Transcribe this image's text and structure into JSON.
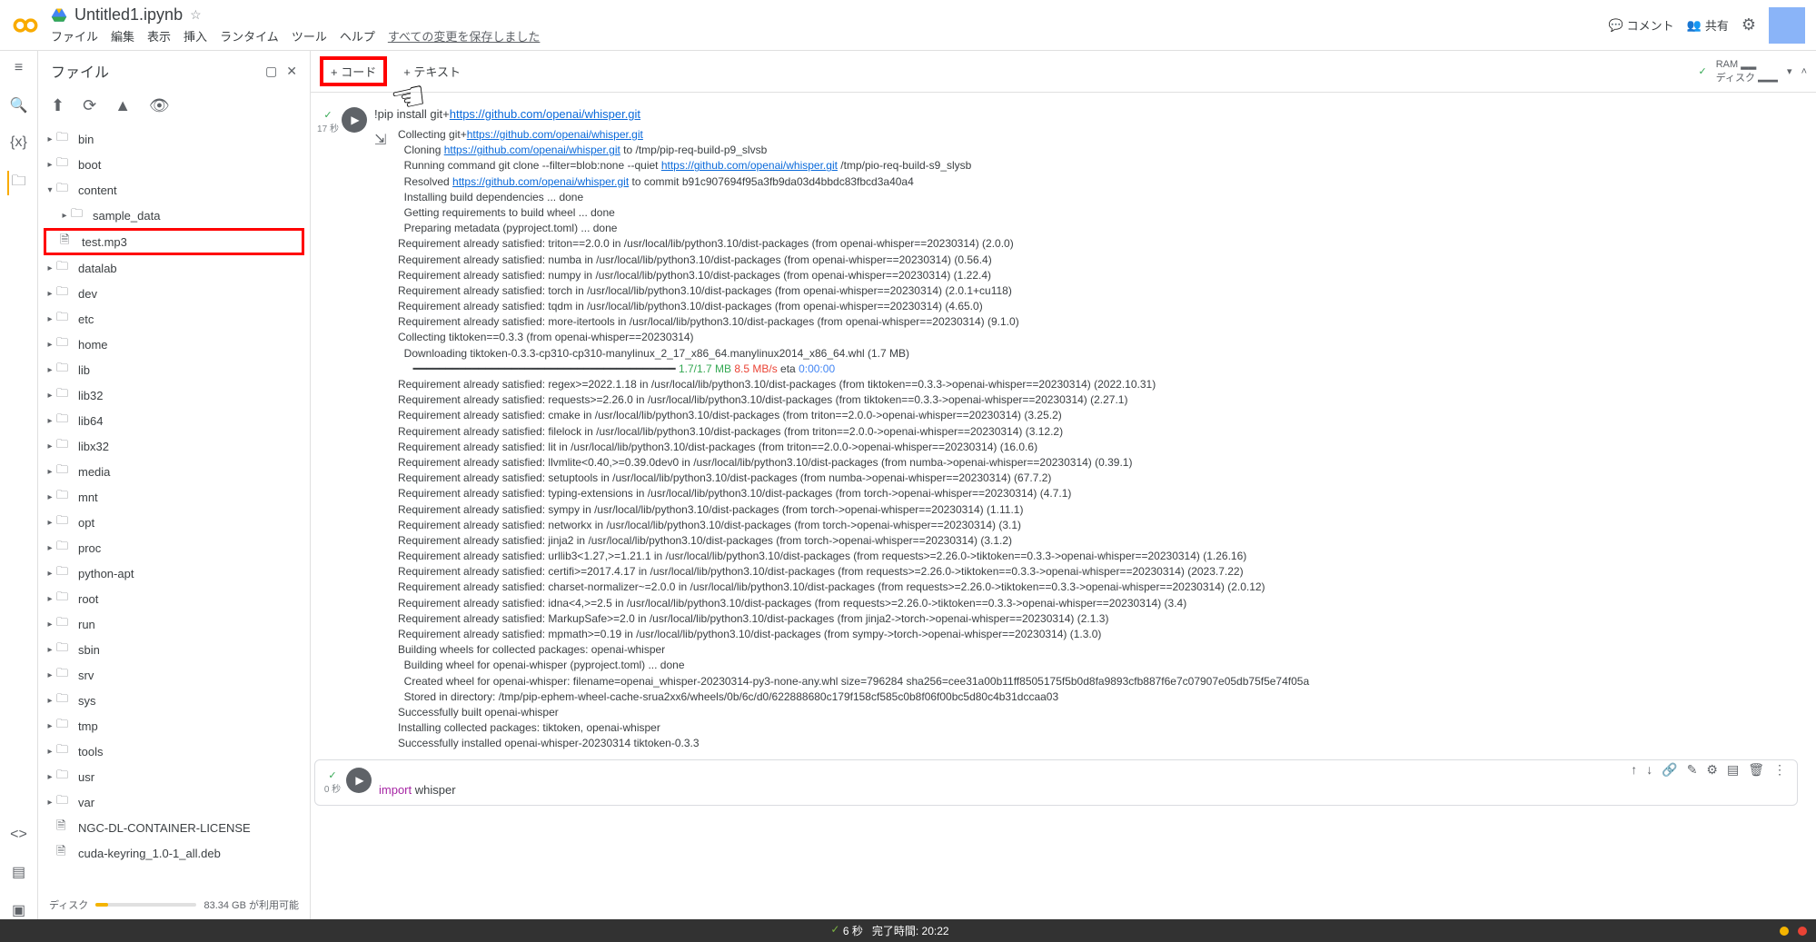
{
  "header": {
    "doc_title": "Untitled1.ipynb",
    "menu": {
      "file": "ファイル",
      "edit": "編集",
      "view": "表示",
      "insert": "挿入",
      "runtime": "ランタイム",
      "tools": "ツール",
      "help": "ヘルプ",
      "save_msg": "すべての変更を保存しました"
    },
    "comment": "コメント",
    "share": "共有"
  },
  "resource": {
    "ram": "RAM",
    "disk": "ディスク"
  },
  "toolbar": {
    "code": "+ コード",
    "text": "+ テキスト"
  },
  "file_pane": {
    "title": "ファイル",
    "tree": {
      "bin": "bin",
      "boot": "boot",
      "content": "content",
      "sample_data": "sample_data",
      "test_mp3": "test.mp3",
      "datalab": "datalab",
      "dev": "dev",
      "etc": "etc",
      "home": "home",
      "lib": "lib",
      "lib32": "lib32",
      "lib64": "lib64",
      "libx32": "libx32",
      "media": "media",
      "mnt": "mnt",
      "opt": "opt",
      "proc": "proc",
      "python_apt": "python-apt",
      "root": "root",
      "run": "run",
      "sbin": "sbin",
      "srv": "srv",
      "sys": "sys",
      "tmp": "tmp",
      "tools": "tools",
      "usr": "usr",
      "var": "var",
      "file1": "NGC-DL-CONTAINER-LICENSE",
      "file2": "cuda-keyring_1.0-1_all.deb"
    },
    "disk_label": "ディスク",
    "disk_avail": "83.34 GB が利用可能"
  },
  "cells": {
    "cell1_count": "17 秒",
    "cell1_code_prefix": "!pip install git+",
    "cell1_code_link": "https://github.com/openai/whisper.git",
    "cell2_kw": "import",
    "cell2_rest": " whisper"
  },
  "output_lines": {
    "l1a": "Collecting git+",
    "l1b": "https://github.com/openai/whisper.git",
    "l2a": "  Cloning ",
    "l2b": "https://github.com/openai/whisper.git",
    "l2c": " to /tmp/pip-req-build-p9_slvsb",
    "l3a": "  Running command git clone --filter=blob:none --quiet ",
    "l3b": "https://github.com/openai/whisper.git",
    "l3c": " /tmp/pio-req-build-s9_slysb",
    "l4a": "  Resolved ",
    "l4b": "https://github.com/openai/whisper.git",
    "l4c": " to commit b91c907694f95a3fb9da03d4bbdc83fbcd3a40a4",
    "l5": "  Installing build dependencies ... done",
    "l6": "  Getting requirements to build wheel ... done",
    "l7": "  Preparing metadata (pyproject.toml) ... done",
    "l8": "Requirement already satisfied: triton==2.0.0 in /usr/local/lib/python3.10/dist-packages (from openai-whisper==20230314) (2.0.0)",
    "l9": "Requirement already satisfied: numba in /usr/local/lib/python3.10/dist-packages (from openai-whisper==20230314) (0.56.4)",
    "l10": "Requirement already satisfied: numpy in /usr/local/lib/python3.10/dist-packages (from openai-whisper==20230314) (1.22.4)",
    "l11": "Requirement already satisfied: torch in /usr/local/lib/python3.10/dist-packages (from openai-whisper==20230314) (2.0.1+cu118)",
    "l12": "Requirement already satisfied: tqdm in /usr/local/lib/python3.10/dist-packages (from openai-whisper==20230314) (4.65.0)",
    "l13": "Requirement already satisfied: more-itertools in /usr/local/lib/python3.10/dist-packages (from openai-whisper==20230314) (9.1.0)",
    "l14": "Collecting tiktoken==0.3.3 (from openai-whisper==20230314)",
    "l15": "  Downloading tiktoken-0.3.3-cp310-cp310-manylinux_2_17_x86_64.manylinux2014_x86_64.whl (1.7 MB)",
    "l16a": "     ━━━━━━━━━━━━━━━━━━━━━━━━━━━━━━━━━━━━━━━━",
    "l16b": " 1.7/1.7 MB",
    "l16c": " 8.5 MB/s",
    "l16d": " eta ",
    "l16e": "0:00:00",
    "l17": "Requirement already satisfied: regex>=2022.1.18 in /usr/local/lib/python3.10/dist-packages (from tiktoken==0.3.3->openai-whisper==20230314) (2022.10.31)",
    "l18": "Requirement already satisfied: requests>=2.26.0 in /usr/local/lib/python3.10/dist-packages (from tiktoken==0.3.3->openai-whisper==20230314) (2.27.1)",
    "l19": "Requirement already satisfied: cmake in /usr/local/lib/python3.10/dist-packages (from triton==2.0.0->openai-whisper==20230314) (3.25.2)",
    "l20": "Requirement already satisfied: filelock in /usr/local/lib/python3.10/dist-packages (from triton==2.0.0->openai-whisper==20230314) (3.12.2)",
    "l21": "Requirement already satisfied: lit in /usr/local/lib/python3.10/dist-packages (from triton==2.0.0->openai-whisper==20230314) (16.0.6)",
    "l22": "Requirement already satisfied: llvmlite<0.40,>=0.39.0dev0 in /usr/local/lib/python3.10/dist-packages (from numba->openai-whisper==20230314) (0.39.1)",
    "l23": "Requirement already satisfied: setuptools in /usr/local/lib/python3.10/dist-packages (from numba->openai-whisper==20230314) (67.7.2)",
    "l24": "Requirement already satisfied: typing-extensions in /usr/local/lib/python3.10/dist-packages (from torch->openai-whisper==20230314) (4.7.1)",
    "l25": "Requirement already satisfied: sympy in /usr/local/lib/python3.10/dist-packages (from torch->openai-whisper==20230314) (1.11.1)",
    "l26": "Requirement already satisfied: networkx in /usr/local/lib/python3.10/dist-packages (from torch->openai-whisper==20230314) (3.1)",
    "l27": "Requirement already satisfied: jinja2 in /usr/local/lib/python3.10/dist-packages (from torch->openai-whisper==20230314) (3.1.2)",
    "l28": "Requirement already satisfied: urllib3<1.27,>=1.21.1 in /usr/local/lib/python3.10/dist-packages (from requests>=2.26.0->tiktoken==0.3.3->openai-whisper==20230314) (1.26.16)",
    "l29": "Requirement already satisfied: certifi>=2017.4.17 in /usr/local/lib/python3.10/dist-packages (from requests>=2.26.0->tiktoken==0.3.3->openai-whisper==20230314) (2023.7.22)",
    "l30": "Requirement already satisfied: charset-normalizer~=2.0.0 in /usr/local/lib/python3.10/dist-packages (from requests>=2.26.0->tiktoken==0.3.3->openai-whisper==20230314) (2.0.12)",
    "l31": "Requirement already satisfied: idna<4,>=2.5 in /usr/local/lib/python3.10/dist-packages (from requests>=2.26.0->tiktoken==0.3.3->openai-whisper==20230314) (3.4)",
    "l32": "Requirement already satisfied: MarkupSafe>=2.0 in /usr/local/lib/python3.10/dist-packages (from jinja2->torch->openai-whisper==20230314) (2.1.3)",
    "l33": "Requirement already satisfied: mpmath>=0.19 in /usr/local/lib/python3.10/dist-packages (from sympy->torch->openai-whisper==20230314) (1.3.0)",
    "l34": "Building wheels for collected packages: openai-whisper",
    "l35": "  Building wheel for openai-whisper (pyproject.toml) ... done",
    "l36": "  Created wheel for openai-whisper: filename=openai_whisper-20230314-py3-none-any.whl size=796284 sha256=cee31a00b11ff8505175f5b0d8fa9893cfb887f6e7c07907e05db75f5e74f05a",
    "l37": "  Stored in directory: /tmp/pip-ephem-wheel-cache-srua2xx6/wheels/0b/6c/d0/622888680c179f158cf585c0b8f06f00bc5d80c4b31dccaa03",
    "l38": "Successfully built openai-whisper",
    "l39": "Installing collected packages: tiktoken, openai-whisper",
    "l40": "Successfully installed openai-whisper-20230314 tiktoken-0.3.3"
  },
  "bottom": {
    "status": "6 秒",
    "done": "完了時間: 20:22"
  }
}
